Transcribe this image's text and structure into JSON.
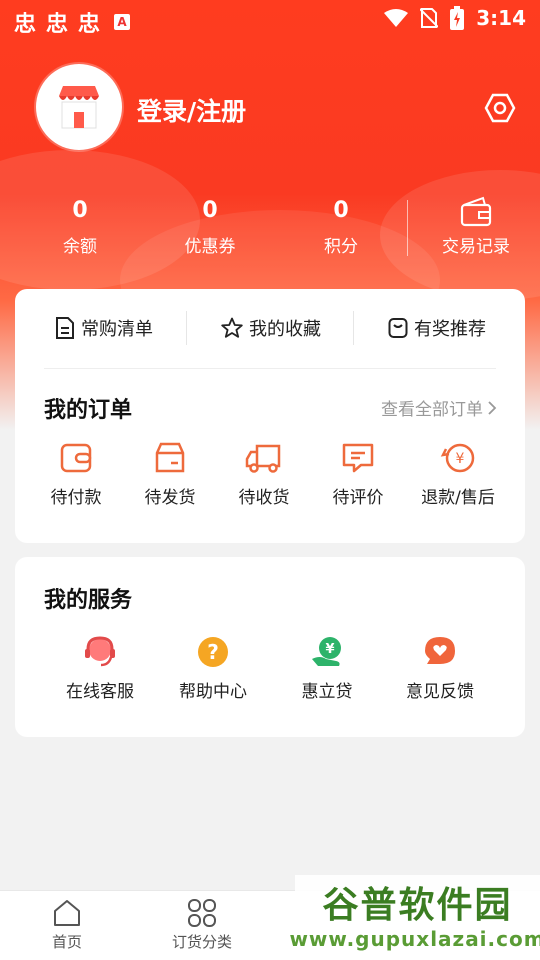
{
  "status_bar": {
    "time": "3:14",
    "left_icons": [
      "忠",
      "忠",
      "忠"
    ],
    "badge": "A"
  },
  "profile": {
    "login_label": "登录/注册"
  },
  "stats": [
    {
      "value": "0",
      "label": "余额"
    },
    {
      "value": "0",
      "label": "优惠券"
    },
    {
      "value": "0",
      "label": "积分"
    }
  ],
  "trade_record": {
    "label": "交易记录"
  },
  "quick_links": [
    {
      "label": "常购清单",
      "icon": "list-icon"
    },
    {
      "label": "我的收藏",
      "icon": "star-icon"
    },
    {
      "label": "有奖推荐",
      "icon": "gift-icon"
    }
  ],
  "orders": {
    "title": "我的订单",
    "view_all": "查看全部订单",
    "items": [
      {
        "label": "待付款",
        "icon": "wallet-icon"
      },
      {
        "label": "待发货",
        "icon": "box-icon"
      },
      {
        "label": "待收货",
        "icon": "truck-icon"
      },
      {
        "label": "待评价",
        "icon": "comment-icon"
      },
      {
        "label": "退款/售后",
        "icon": "refund-icon"
      }
    ]
  },
  "services": {
    "title": "我的服务",
    "items": [
      {
        "label": "在线客服",
        "icon": "headset-icon"
      },
      {
        "label": "帮助中心",
        "icon": "help-icon"
      },
      {
        "label": "惠立贷",
        "icon": "loan-icon"
      },
      {
        "label": "意见反馈",
        "icon": "feedback-icon"
      }
    ]
  },
  "bottom_nav": [
    {
      "label": "首页",
      "icon": "home-icon"
    },
    {
      "label": "订货分类",
      "icon": "category-icon"
    }
  ],
  "watermark": {
    "title": "谷普软件园",
    "url": "www.gupuxlazai.com"
  },
  "colors": {
    "brand_red": "#f83b22",
    "orange": "#ee6a3c",
    "green": "#2db36a",
    "yellow": "#f5a623"
  }
}
